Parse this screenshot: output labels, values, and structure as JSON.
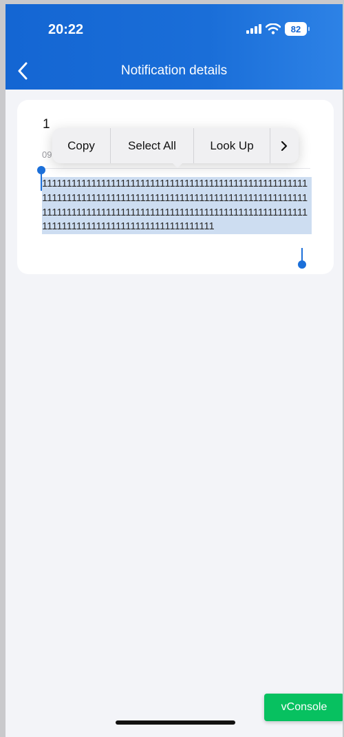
{
  "status_bar": {
    "time": "20:22",
    "battery": "82"
  },
  "nav": {
    "title": "Notification details",
    "back_icon": "chevron-left-icon"
  },
  "notification": {
    "title": "1",
    "date": "09",
    "content": "11111111111111111111111111111111111111111111111111111111111111111111111111111111111111111111111111111111111111111111111111111111111111111111111111111111111111111111111111111111111111111111111111111"
  },
  "context_menu": {
    "items": [
      "Copy",
      "Select All",
      "Look Up"
    ],
    "more_icon": "chevron-right-icon"
  },
  "debug": {
    "vconsole_label": "vConsole"
  },
  "colors": {
    "brand_blue": "#1466d3",
    "selection": "#cdddf1",
    "vconsole_green": "#07c160"
  }
}
